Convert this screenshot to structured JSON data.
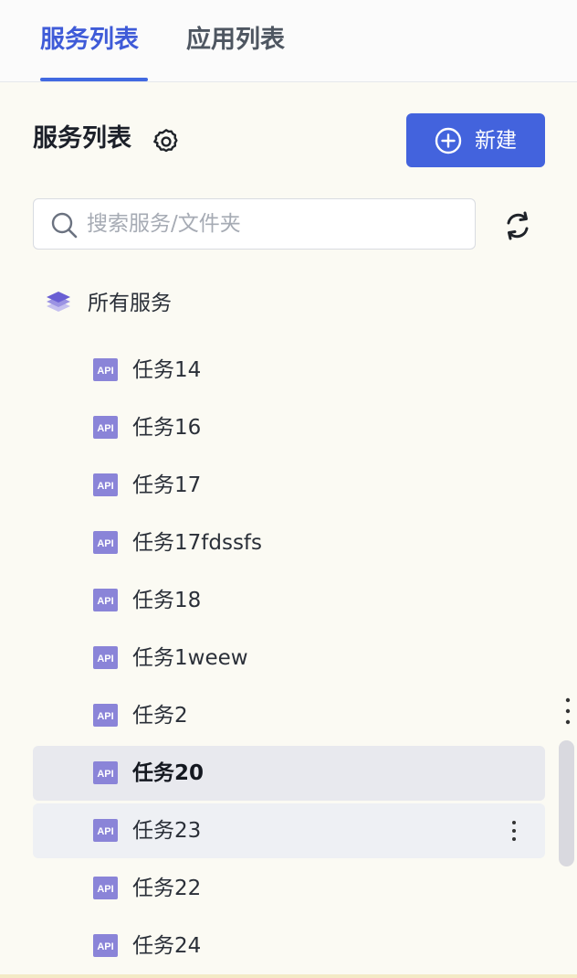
{
  "tabs": [
    {
      "label": "服务列表",
      "active": true
    },
    {
      "label": "应用列表",
      "active": false
    }
  ],
  "panel": {
    "title": "服务列表",
    "new_button_label": "新建",
    "search": {
      "placeholder": "搜索服务/文件夹",
      "value": ""
    },
    "all_services_label": "所有服务"
  },
  "services": [
    {
      "name": "任务14",
      "state": "normal"
    },
    {
      "name": "任务16",
      "state": "normal"
    },
    {
      "name": "任务17",
      "state": "normal"
    },
    {
      "name": "任务17fdssfs",
      "state": "normal"
    },
    {
      "name": "任务18",
      "state": "normal"
    },
    {
      "name": "任务1weew",
      "state": "normal"
    },
    {
      "name": "任务2",
      "state": "normal"
    },
    {
      "name": "任务20",
      "state": "selected"
    },
    {
      "name": "任务23",
      "state": "hovered"
    },
    {
      "name": "任务22",
      "state": "normal"
    },
    {
      "name": "任务24",
      "state": "normal"
    }
  ],
  "icons": {
    "settings": "gear-icon",
    "new": "plus-circle-icon",
    "search": "search-icon",
    "refresh": "refresh-icon",
    "all_services": "layers-icon",
    "service": "api-icon",
    "more": "more-vertical-icon"
  },
  "colors": {
    "accent": "#4363dd",
    "tab_active": "#3f5bd8",
    "api_icon": "#8a84d8",
    "selected_row": "#e8e9ee",
    "hover_row": "#eef0f4"
  }
}
